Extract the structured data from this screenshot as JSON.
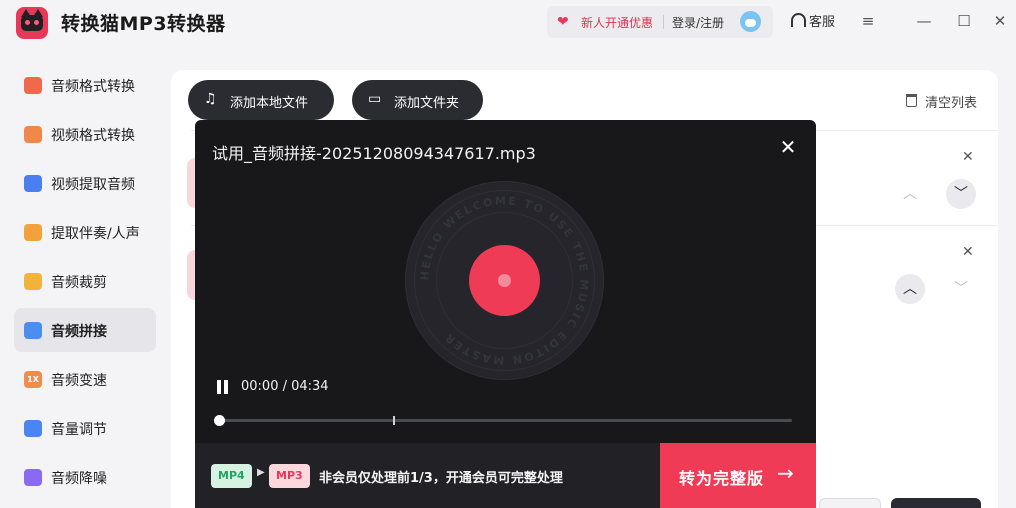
{
  "app": {
    "title": "转换猫MP3转换器",
    "promo": "新人开通优惠",
    "login": "登录/注册",
    "service": "客服"
  },
  "sidebar": {
    "items": [
      {
        "label": "音频格式转换",
        "icon": "audio-format-icon",
        "color": "#ef6a4a"
      },
      {
        "label": "视频格式转换",
        "icon": "video-format-icon",
        "color": "#f2874a"
      },
      {
        "label": "视频提取音频",
        "icon": "extract-audio-icon",
        "color": "#4a7ff2"
      },
      {
        "label": "提取伴奏/人声",
        "icon": "vocal-icon",
        "color": "#f2a23a"
      },
      {
        "label": "音频裁剪",
        "icon": "cut-icon",
        "color": "#f2b33a"
      },
      {
        "label": "音频拼接",
        "icon": "merge-icon",
        "color": "#4a8ef2"
      },
      {
        "label": "音频变速",
        "icon": "speed-icon",
        "color": "#f28c4a"
      },
      {
        "label": "音量调节",
        "icon": "volume-icon",
        "color": "#4a86f2"
      },
      {
        "label": "音频降噪",
        "icon": "denoise-icon",
        "color": "#8a6af2"
      }
    ],
    "active_index": 5,
    "speed_icon_text": "1X"
  },
  "toolbar": {
    "add_local_file": "添加本地文件",
    "add_folder": "添加文件夹",
    "clear_list": "清空列表"
  },
  "player": {
    "title": "试用_音频拼接-20251208094347617.mp3",
    "time": "00:00 / 04:34",
    "progress": 0.0,
    "trial_mark": 0.333,
    "disc_text": "HELLO WELCOME TO USE THE MUSIC EDITON MASTER",
    "from_format": "MP4",
    "to_format": "MP3",
    "notice": "非会员仅处理前1/3，开通会员可完整处理",
    "upgrade_label": "转为完整版"
  },
  "colors": {
    "accent": "#ef3b56",
    "player_bg": "#18181b",
    "dark_button": "#2b2b32"
  }
}
